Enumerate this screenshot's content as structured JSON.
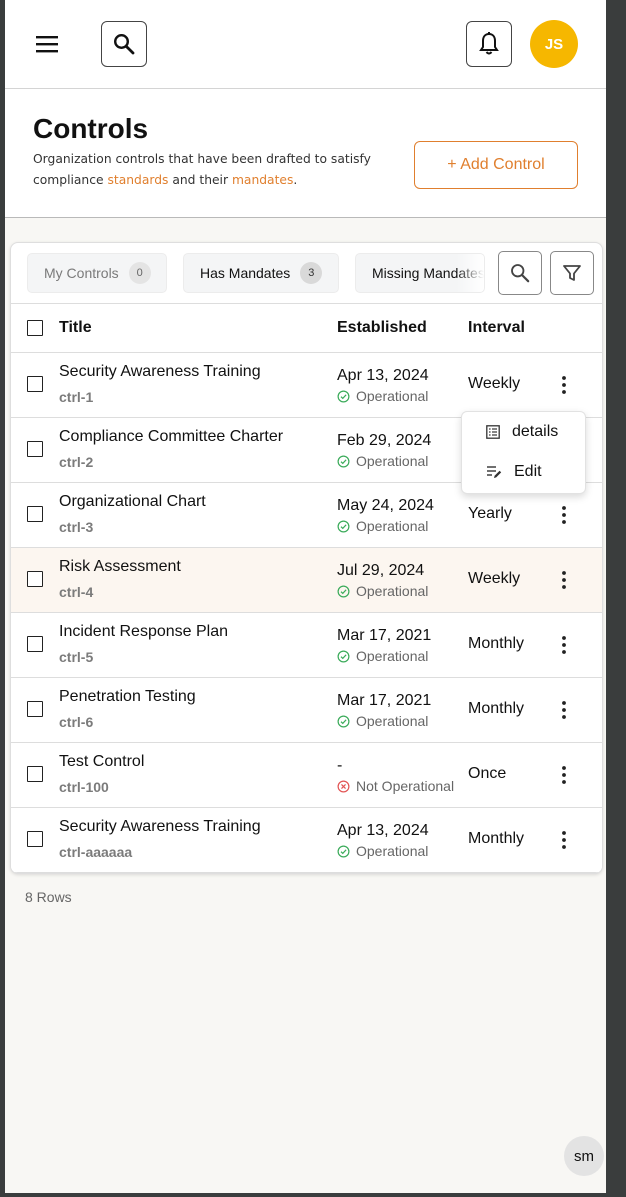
{
  "header": {
    "avatar_initials": "JS"
  },
  "page": {
    "title": "Controls",
    "desc_part1": "Organization controls that have been drafted to satisfy compliance ",
    "desc_link1": "standards",
    "desc_part2": " and their ",
    "desc_link2": "mandates",
    "desc_part3": ".",
    "add_button": "+ Add Control"
  },
  "toolbar": {
    "tabs": [
      {
        "label": "My Controls",
        "count": "0"
      },
      {
        "label": "Has Mandates",
        "count": "3"
      },
      {
        "label": "Missing Mandates",
        "count": ""
      }
    ]
  },
  "table": {
    "columns": [
      "Title",
      "Established",
      "Interval"
    ],
    "rows": [
      {
        "title": "Security Awareness Training",
        "code": "ctrl-1",
        "date": "Apr 13, 2024",
        "status": "Operational",
        "interval": "Weekly"
      },
      {
        "title": "Compliance Committee Charter",
        "code": "ctrl-2",
        "date": "Feb 29, 2024",
        "status": "Operational",
        "interval": ""
      },
      {
        "title": "Organizational Chart",
        "code": "ctrl-3",
        "date": "May 24, 2024",
        "status": "Operational",
        "interval": "Yearly"
      },
      {
        "title": "Risk Assessment",
        "code": "ctrl-4",
        "date": "Jul 29, 2024",
        "status": "Operational",
        "interval": "Weekly"
      },
      {
        "title": "Incident Response Plan",
        "code": "ctrl-5",
        "date": "Mar 17, 2021",
        "status": "Operational",
        "interval": "Monthly"
      },
      {
        "title": "Penetration Testing",
        "code": "ctrl-6",
        "date": "Mar 17, 2021",
        "status": "Operational",
        "interval": "Monthly"
      },
      {
        "title": "Test Control",
        "code": "ctrl-100",
        "date": "-",
        "status": "Not Operational",
        "interval": "Once"
      },
      {
        "title": "Security Awareness Training",
        "code": "ctrl-aaaaaa",
        "date": "Apr 13, 2024",
        "status": "Operational",
        "interval": "Monthly"
      }
    ],
    "rows_count": "8 Rows"
  },
  "popup_menu": {
    "details": "details",
    "edit": "Edit"
  },
  "corner_badge": "sm",
  "colors": {
    "accent": "#e07f2e",
    "avatar": "#f6b700",
    "ok": "#3bab5a",
    "error": "#e25555"
  }
}
